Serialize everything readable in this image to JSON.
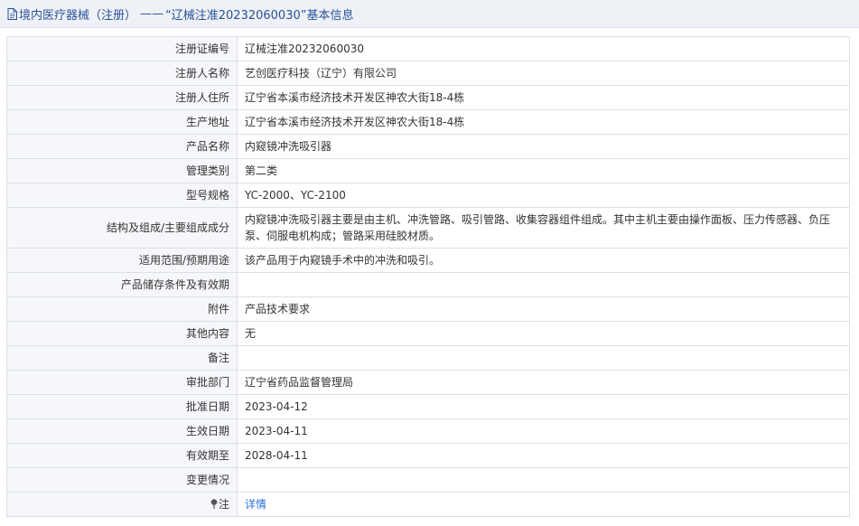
{
  "header": {
    "category": "境内医疗器械（注册）",
    "separator": "——",
    "reg_quoted": "“辽械注准20232060030”",
    "suffix": "基本信息"
  },
  "rows": [
    {
      "label": "注册证编号",
      "value": "辽械注准20232060030"
    },
    {
      "label": "注册人名称",
      "value": "艺创医疗科技（辽宁）有限公司"
    },
    {
      "label": "注册人住所",
      "value": "辽宁省本溪市经济技术开发区神农大街18-4栋"
    },
    {
      "label": "生产地址",
      "value": "辽宁省本溪市经济技术开发区神农大街18-4栋"
    },
    {
      "label": "产品名称",
      "value": "内窥镜冲洗吸引器"
    },
    {
      "label": "管理类别",
      "value": "第二类"
    },
    {
      "label": "型号规格",
      "value": "YC-2000、YC-2100"
    },
    {
      "label": "结构及组成/主要组成成分",
      "value": "内窥镜冲洗吸引器主要是由主机、冲洗管路、吸引管路、收集容器组件组成。其中主机主要由操作面板、压力传感器、负压泵、伺服电机构成；管路采用硅胶材质。"
    },
    {
      "label": "适用范围/预期用途",
      "value": "该产品用于内窥镜手术中的冲洗和吸引。"
    },
    {
      "label": "产品储存条件及有效期",
      "value": ""
    },
    {
      "label": "附件",
      "value": "产品技术要求"
    },
    {
      "label": "其他内容",
      "value": "无"
    },
    {
      "label": "备注",
      "value": ""
    },
    {
      "label": "审批部门",
      "value": "辽宁省药品监督管理局"
    },
    {
      "label": "批准日期",
      "value": "2023-04-12"
    },
    {
      "label": "生效日期",
      "value": "2023-04-11"
    },
    {
      "label": "有效期至",
      "value": "2028-04-11"
    },
    {
      "label": "变更情况",
      "value": ""
    }
  ],
  "note_row": {
    "label": "注",
    "link": "详情",
    "icon": "pin-icon"
  },
  "colors": {
    "header_bg": "#eef1f6",
    "label_bg": "#f5f7fa",
    "border": "#dcdfe6",
    "title_text": "#2a5298",
    "link": "#2a6fdb"
  }
}
